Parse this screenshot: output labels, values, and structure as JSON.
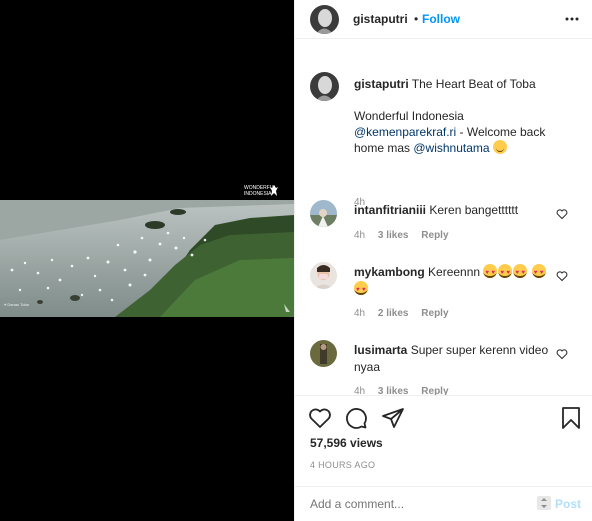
{
  "media": {
    "watermark_line1": "WONDERFUL",
    "watermark_line2": "INDONESIA",
    "location_text": "Danau Toba"
  },
  "header": {
    "username": "gistaputri",
    "separator": "•",
    "follow_label": "Follow",
    "more_icon": "more-horizontal-icon"
  },
  "caption": {
    "username": "gistaputri",
    "title": "The Heart Beat of Toba",
    "line2": "Wonderful Indonesia",
    "mention1": "@kemenparekraf.ri",
    "text_after_mention1": " - Welcome back home mas ",
    "mention2": "@wishnutama",
    "time": "4h"
  },
  "comments": [
    {
      "username": "intanfitrianiii",
      "text": "Keren bangetttttt",
      "time": "4h",
      "likes": "3 likes",
      "reply": "Reply"
    },
    {
      "username": "mykambong",
      "text": "Kereennn",
      "time": "4h",
      "likes": "2 likes",
      "reply": "Reply"
    },
    {
      "username": "lusimarta",
      "text": "Super super kerenn video nyaa",
      "time": "4h",
      "likes": "3 likes",
      "reply": "Reply"
    }
  ],
  "actions": {
    "views": "57,596 views",
    "posted_ago": "4 HOURS AGO"
  },
  "add_comment": {
    "placeholder": "Add a comment...",
    "post_label": "Post"
  },
  "colors": {
    "link": "#0095f6",
    "mention": "#00376b",
    "muted": "#8e8e8e",
    "post_disabled": "#b2dffc"
  }
}
